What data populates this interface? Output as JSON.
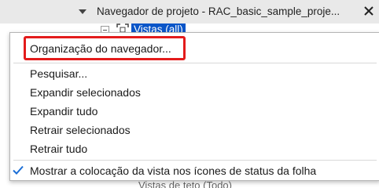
{
  "panel": {
    "title": "Navegador de projeto - RAC_basic_sample_proje...",
    "tree_root_label": "Vistas (all)",
    "bottom_partial_text": "Vistas de teto (Todo)"
  },
  "context_menu": {
    "items": [
      {
        "label": "Organização do navegador..."
      },
      {
        "label": "Pesquisar..."
      },
      {
        "label": "Expandir selecionados"
      },
      {
        "label": "Expandir tudo"
      },
      {
        "label": "Retrair selecionados"
      },
      {
        "label": "Retrair tudo"
      },
      {
        "label": "Mostrar a colocação da vista nos ícones de status da folha",
        "checked": true
      }
    ]
  },
  "colors": {
    "highlight_border": "#e31b1b",
    "selection": "#0a55c8",
    "check": "#1b6ed6"
  }
}
